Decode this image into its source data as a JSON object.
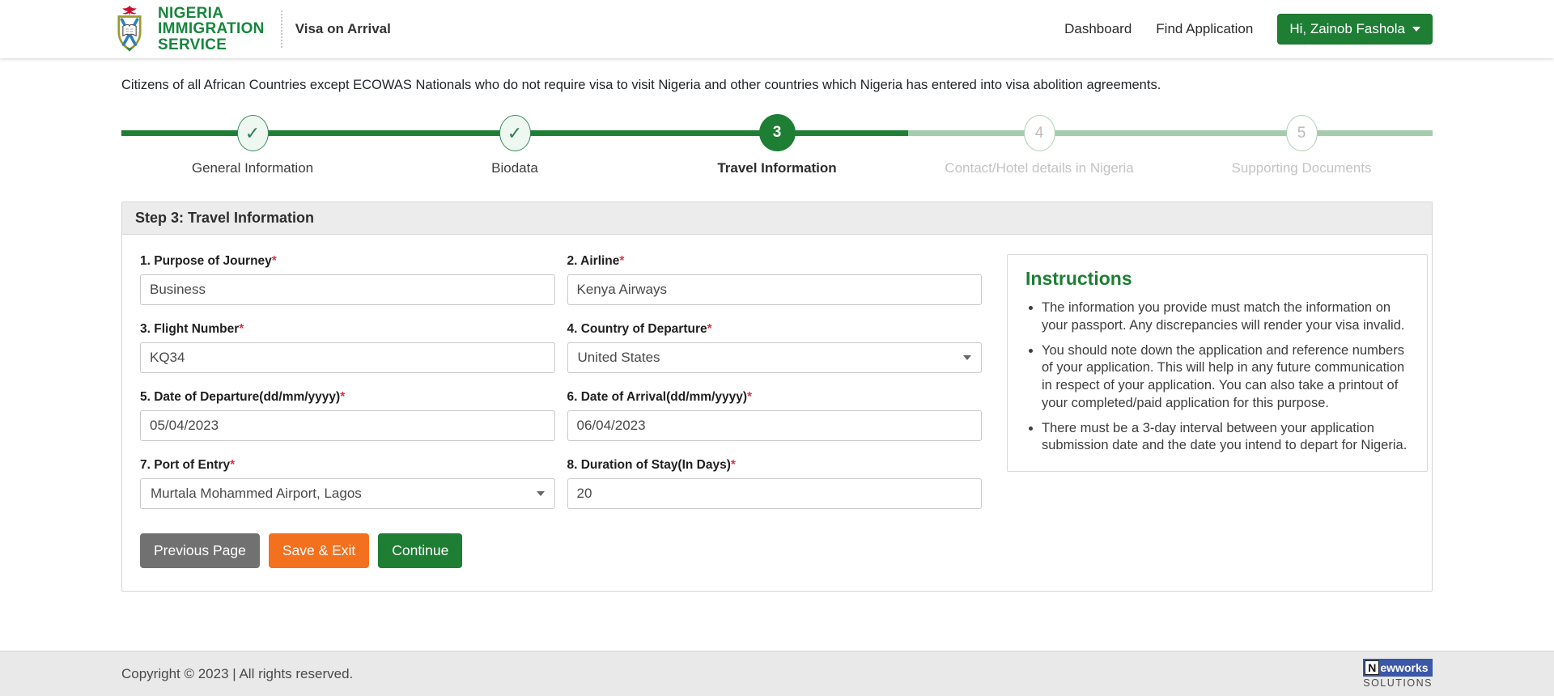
{
  "colors": {
    "brand_green": "#1e7e34",
    "brand_text_green": "#17863d",
    "stepper_light_green": "#a5cbad",
    "save_orange": "#f3701e",
    "prev_gray": "#717171",
    "required_red": "#dc3545",
    "footer_bg": "#e9e9e9",
    "newworks_blue": "#3a57a8"
  },
  "header": {
    "brand_line1": "NIGERIA",
    "brand_line2": "IMMIGRATION",
    "brand_line3": "SERVICE",
    "app_name": "Visa on Arrival",
    "nav": [
      {
        "label": "Dashboard"
      },
      {
        "label": "Find Application"
      }
    ],
    "user_button_label": "Hi, Zainob Fashola"
  },
  "intro_text": "Citizens of all African Countries except ECOWAS Nationals who do not require visa to visit Nigeria and other countries which Nigeria has entered into visa abolition agreements.",
  "stepper": {
    "progress_style": "width:60%",
    "steps": [
      {
        "marker": "✓",
        "label": "General Information",
        "status": "completed"
      },
      {
        "marker": "✓",
        "label": "Biodata",
        "status": "completed"
      },
      {
        "marker": "3",
        "label": "Travel Information",
        "status": "active"
      },
      {
        "marker": "4",
        "label": "Contact/Hotel details in Nigeria",
        "status": "pending"
      },
      {
        "marker": "5",
        "label": "Supporting Documents",
        "status": "pending"
      }
    ]
  },
  "form": {
    "title": "Step 3: Travel Information",
    "required_mark": "*",
    "fields": [
      {
        "label": "1. Purpose of Journey",
        "value": "Business",
        "type": "text"
      },
      {
        "label": "2. Airline",
        "value": "Kenya Airways",
        "type": "text"
      },
      {
        "label": "3. Flight Number",
        "value": "KQ34",
        "type": "text"
      },
      {
        "label": "4. Country of Departure",
        "value": "United States",
        "type": "select"
      },
      {
        "label": "5. Date of Departure(dd/mm/yyyy)",
        "value": "05/04/2023",
        "type": "text"
      },
      {
        "label": "6. Date of Arrival(dd/mm/yyyy)",
        "value": "06/04/2023",
        "type": "text"
      },
      {
        "label": "7. Port of Entry",
        "value": "Murtala Mohammed Airport, Lagos",
        "type": "select"
      },
      {
        "label": "8. Duration of Stay(In Days)",
        "value": "20",
        "type": "text"
      }
    ],
    "buttons": {
      "previous": "Previous Page",
      "save_exit": "Save & Exit",
      "continue": "Continue"
    }
  },
  "instructions": {
    "title": "Instructions",
    "items": [
      "The information you provide must match the information on your passport. Any discrepancies will render your visa invalid.",
      "You should note down the application and reference numbers of your application. This will help in any future communication in respect of your application. You can also take a printout of your completed/paid application for this purpose.",
      "There must be a 3-day interval between your application submission date and the date you intend to depart for Nigeria."
    ]
  },
  "footer": {
    "copyright": "Copyright © 2023 | All rights reserved.",
    "logo_n": "N",
    "logo_rest": "ewworks",
    "logo_sub": "SOLUTIONS"
  }
}
